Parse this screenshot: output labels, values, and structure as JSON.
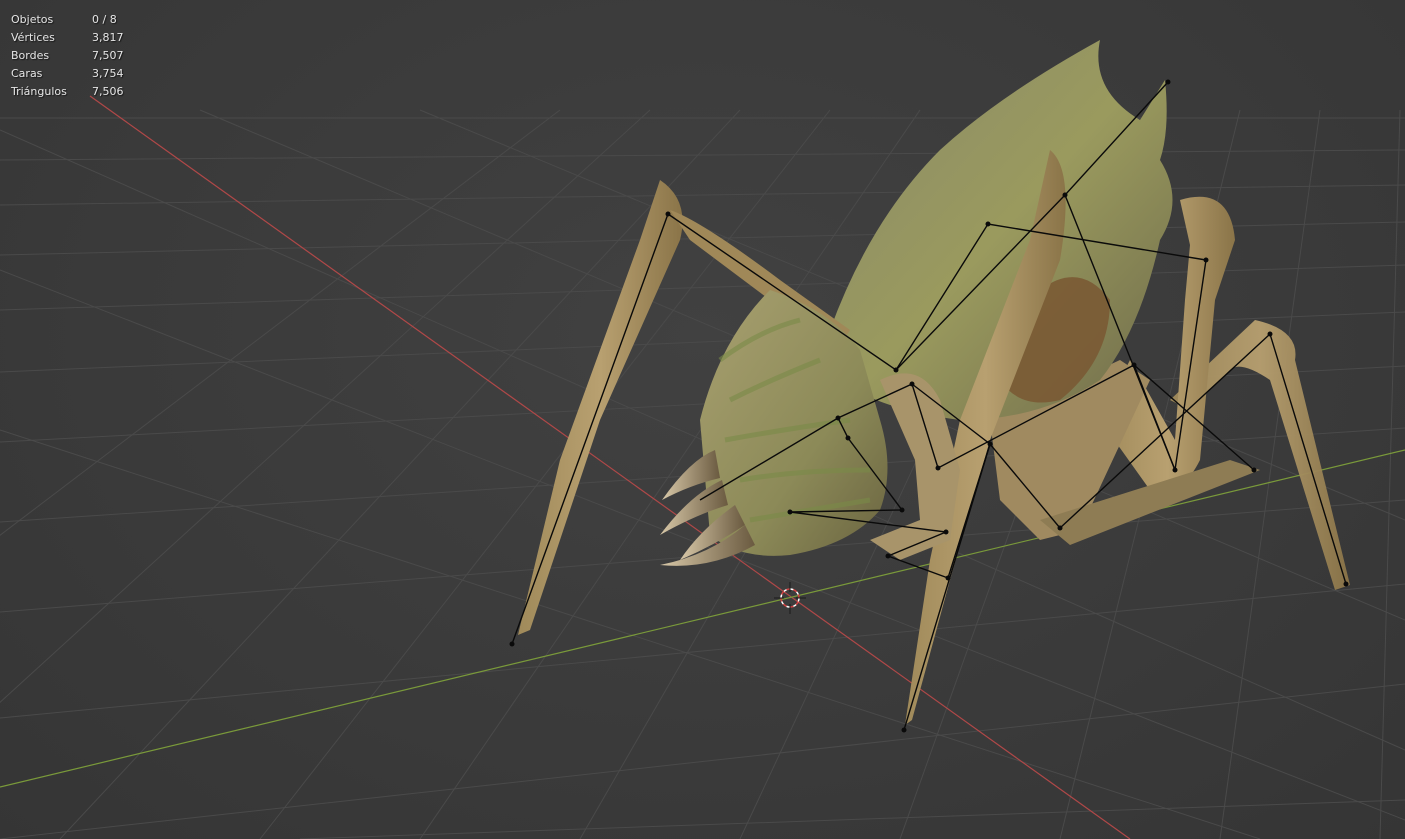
{
  "viewport": {
    "background": "#3a3a3a",
    "grid_color": "#4a4a4a",
    "x_axis_color": "#b04848",
    "y_axis_color": "#7a9a3a",
    "cursor_icon": "3d-cursor-icon",
    "model": "creature-mesh-with-armature"
  },
  "stats": [
    {
      "label": "Objetos",
      "value": "0 / 8"
    },
    {
      "label": "Vértices",
      "value": "3,817"
    },
    {
      "label": "Bordes",
      "value": "7,507"
    },
    {
      "label": "Caras",
      "value": "3,754"
    },
    {
      "label": "Triángulos",
      "value": "7,506"
    }
  ]
}
